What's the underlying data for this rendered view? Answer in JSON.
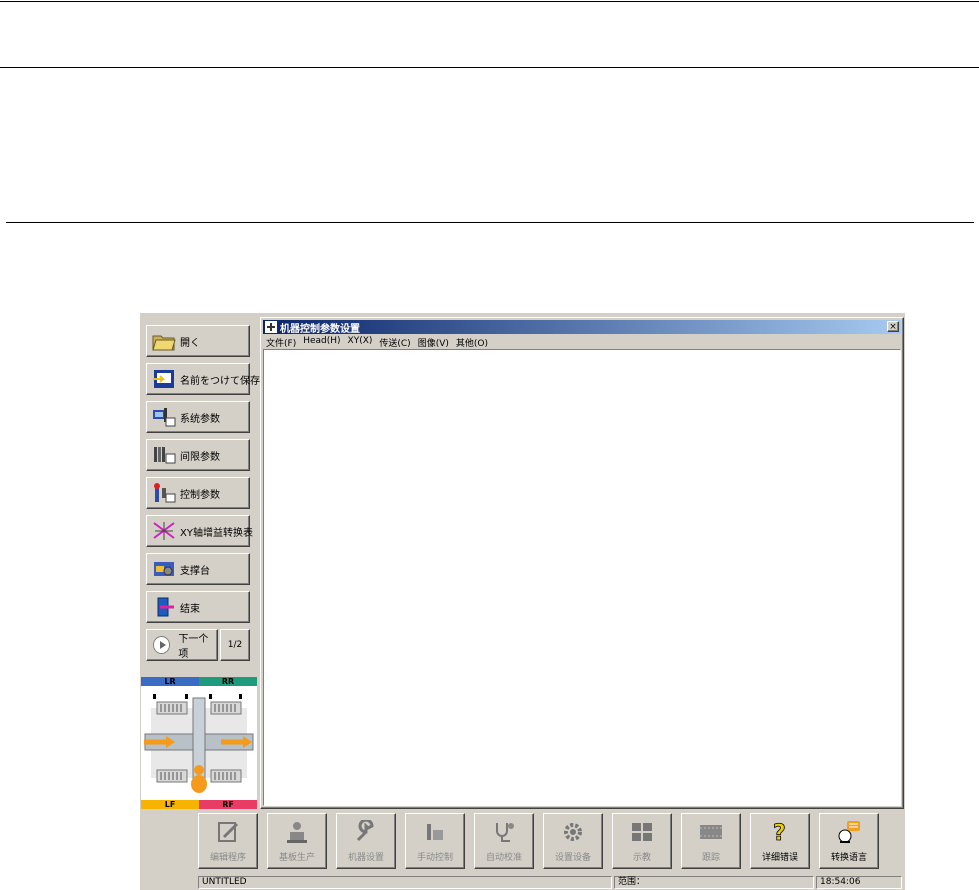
{
  "sidebar": {
    "open": "開く",
    "save_as": "名前をつけて保存",
    "system_params": "系统参数",
    "limit_params": "间限参数",
    "control_params": "控制参数",
    "xy_gain": "XY轴增益转换表",
    "support": "支撑台",
    "exit": "结束",
    "next": "下一个项",
    "page": "1/2"
  },
  "diagram": {
    "lr": "LR",
    "rr": "RR",
    "lf": "LF",
    "rf": "RF"
  },
  "window": {
    "title": "机器控制参数设置",
    "close": "×",
    "menu": [
      "文件(F)",
      "Head(H)",
      "XY(X)",
      "传送(C)",
      "图像(V)",
      "其他(O)"
    ]
  },
  "toolbar": [
    {
      "label": "编辑程序",
      "icon": "edit-program-icon"
    },
    {
      "label": "基板生产",
      "icon": "production-icon"
    },
    {
      "label": "机器设置",
      "icon": "machine-setup-icon"
    },
    {
      "label": "手动控制",
      "icon": "manual-control-icon"
    },
    {
      "label": "自动校准",
      "icon": "auto-calibration-icon"
    },
    {
      "label": "设置设备",
      "icon": "device-setup-icon"
    },
    {
      "label": "示教",
      "icon": "teach-icon"
    },
    {
      "label": "跟踪",
      "icon": "trace-icon"
    },
    {
      "label": "详细错误",
      "icon": "help-question-icon"
    },
    {
      "label": "转换语言",
      "icon": "switch-language-icon"
    }
  ],
  "status": {
    "file": "UNTITLED",
    "range": "范围：",
    "time": "18:54:06"
  },
  "colors": {
    "title_start": "#0a246a",
    "title_end": "#a6caf0",
    "lr": "#3b6cc4",
    "rr": "#1e9a7c",
    "lf": "#f6b400",
    "rf": "#e83c64",
    "arrow": "#f59a1a"
  }
}
